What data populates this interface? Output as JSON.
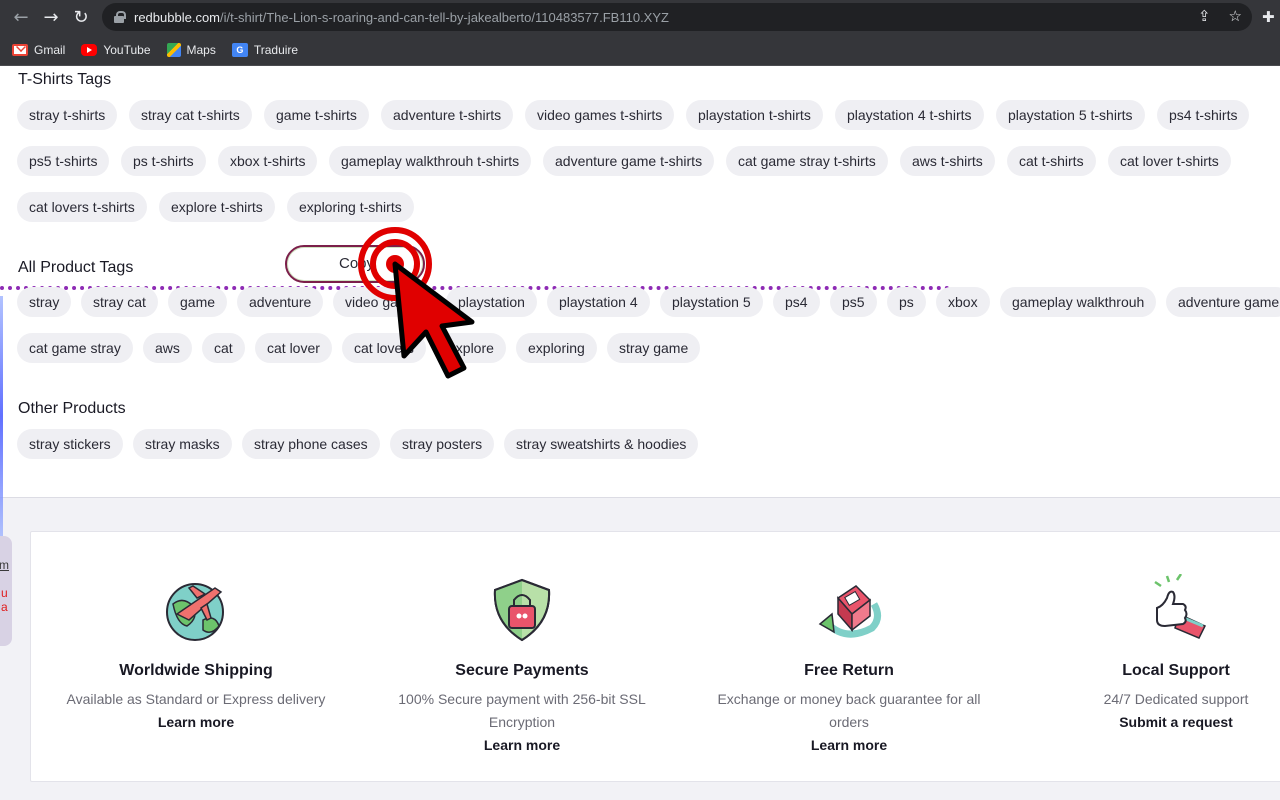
{
  "browser": {
    "url_host": "redbubble.com",
    "url_path": "/i/t-shirt/The-Lion-s-roaring-and-can-tell-by-jakealberto/110483577.FB110.XYZ",
    "bookmarks": [
      {
        "label": "Gmail",
        "icon": "gmail-icon"
      },
      {
        "label": "YouTube",
        "icon": "youtube-icon"
      },
      {
        "label": "Maps",
        "icon": "maps-icon"
      },
      {
        "label": "Traduire",
        "icon": "translate-icon"
      }
    ]
  },
  "tshirt_tags": {
    "title": "T-Shirts Tags",
    "rows": [
      [
        "stray t-shirts",
        "stray cat t-shirts",
        "game t-shirts",
        "adventure t-shirts",
        "video games t-shirts",
        "playstation t-shirts",
        "playstation 4 t-shirts",
        "playstation 5 t-shirts",
        "ps4 t-shirts"
      ],
      [
        "ps5 t-shirts",
        "ps t-shirts",
        "xbox t-shirts",
        "gameplay walkthrouh t-shirts",
        "adventure game t-shirts",
        "cat game stray t-shirts",
        "aws t-shirts",
        "cat t-shirts",
        "cat lover t-shirts"
      ],
      [
        "cat lovers t-shirts",
        "explore t-shirts",
        "exploring t-shirts"
      ]
    ]
  },
  "all_tags": {
    "title": "All Product Tags",
    "copy_label": "Copy",
    "rows": [
      [
        "stray",
        "stray cat",
        "game",
        "adventure",
        "video games",
        "playstation",
        "playstation 4",
        "playstation 5",
        "ps4",
        "ps5",
        "ps",
        "xbox",
        "gameplay walkthrouh",
        "adventure game"
      ],
      [
        "cat game stray",
        "aws",
        "cat",
        "cat lover",
        "cat lovers",
        "explore",
        "exploring",
        "stray game"
      ]
    ]
  },
  "other_products": {
    "title": "Other Products",
    "items": [
      "stray stickers",
      "stray masks",
      "stray phone cases",
      "stray posters",
      "stray sweatshirts & hoodies"
    ]
  },
  "side_widget": {
    "line1": "m",
    "line2": "u",
    "line3": "a"
  },
  "features": [
    {
      "icon": "globe-plane-icon",
      "title": "Worldwide Shipping",
      "desc": "Available as Standard or Express delivery",
      "link": "Learn more"
    },
    {
      "icon": "shield-lock-icon",
      "title": "Secure Payments",
      "desc": "100% Secure payment with 256-bit SSL Encryption",
      "link": "Learn more"
    },
    {
      "icon": "return-box-icon",
      "title": "Free Return",
      "desc": "Exchange or money back guarantee for all orders",
      "link": "Learn more"
    },
    {
      "icon": "thumbs-up-icon",
      "title": "Local Support",
      "desc": "24/7 Dedicated support",
      "link": "Submit a request"
    }
  ],
  "colors": {
    "accent_dotted": "#8e2bb5",
    "annotation_red": "#e00000",
    "chip_bg": "#efeff3"
  }
}
